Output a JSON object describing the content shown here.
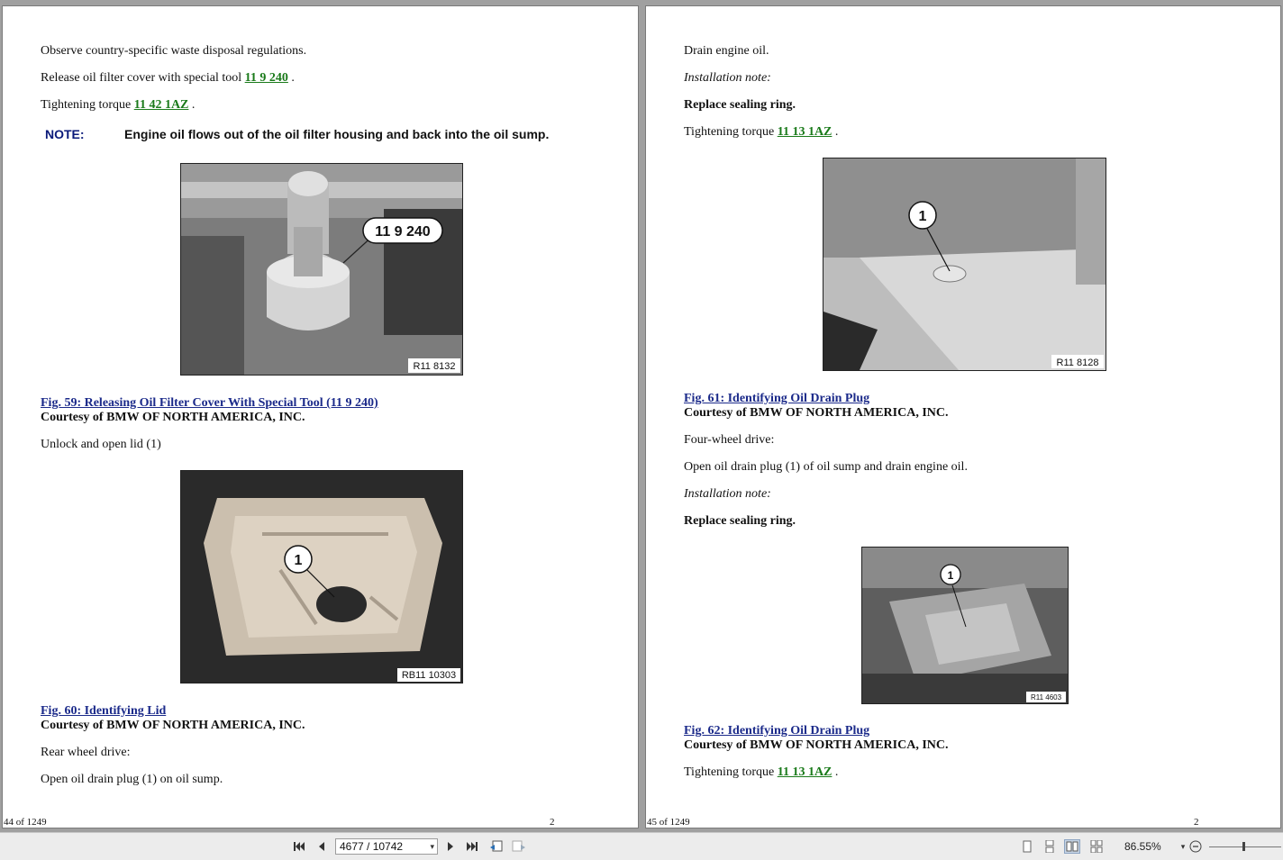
{
  "left_page": {
    "lines": {
      "l1": "Observe country-specific waste disposal regulations.",
      "l2_pre": "Release oil filter cover with special tool ",
      "l2_link": "11 9 240",
      "l2_post": " .",
      "l3_pre": "Tightening torque ",
      "l3_link": "11 42 1AZ",
      "l3_post": " .",
      "note_label": "NOTE:",
      "note_text": "Engine oil flows out of the oil filter housing and back into the oil sump.",
      "fig59": "Fig. 59: Releasing Oil Filter Cover With Special Tool (11 9 240)",
      "courtesy1": "Courtesy of BMW OF NORTH AMERICA, INC.",
      "l4": "Unlock and open lid (1)",
      "fig60": "Fig. 60: Identifying Lid",
      "courtesy2": "Courtesy of BMW OF NORTH AMERICA, INC.",
      "l5": "Rear wheel drive:",
      "l6": "Open oil drain plug (1) on oil sump."
    },
    "img1": {
      "callout": "11 9 240",
      "code": "R11 8132"
    },
    "img2": {
      "callout": "1",
      "code": "RB11 10303"
    },
    "footer_left": "44 of 1249",
    "footer_right": "2"
  },
  "right_page": {
    "lines": {
      "l1": "Drain engine oil.",
      "l2": "Installation note:",
      "l3": "Replace sealing ring.",
      "l4_pre": "Tightening torque ",
      "l4_link": "11 13 1AZ",
      "l4_post": " .",
      "fig61": "Fig. 61: Identifying Oil Drain Plug",
      "courtesy1": "Courtesy of BMW OF NORTH AMERICA, INC.",
      "l5": "Four-wheel drive:",
      "l6": "Open oil drain plug (1) of oil sump and drain engine oil.",
      "l7": "Installation note:",
      "l8": "Replace sealing ring.",
      "fig62": "Fig. 62: Identifying Oil Drain Plug",
      "courtesy2": "Courtesy of BMW OF NORTH AMERICA, INC.",
      "l9_pre": "Tightening torque ",
      "l9_link": "11 13 1AZ",
      "l9_post": " ."
    },
    "img3": {
      "callout": "1",
      "code": "R11 8128"
    },
    "img4": {
      "callout": "1",
      "code": "R11 4603"
    },
    "footer_left": "45 of 1249",
    "footer_right": "2"
  },
  "toolbar": {
    "page_field": "4677 / 10742",
    "zoom": "86.55%"
  }
}
